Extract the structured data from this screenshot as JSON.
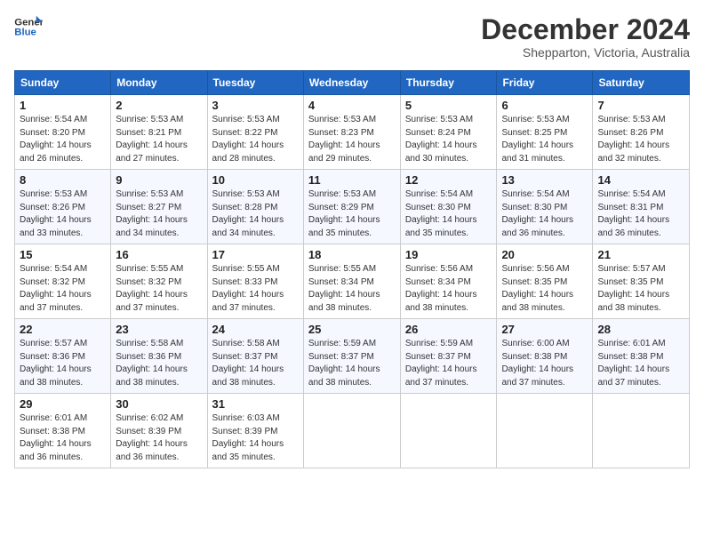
{
  "logo": {
    "line1": "General",
    "line2": "Blue"
  },
  "title": "December 2024",
  "subtitle": "Shepparton, Victoria, Australia",
  "days_header": [
    "Sunday",
    "Monday",
    "Tuesday",
    "Wednesday",
    "Thursday",
    "Friday",
    "Saturday"
  ],
  "weeks": [
    [
      {
        "day": "1",
        "sunrise": "5:54 AM",
        "sunset": "8:20 PM",
        "daylight": "14 hours and 26 minutes."
      },
      {
        "day": "2",
        "sunrise": "5:53 AM",
        "sunset": "8:21 PM",
        "daylight": "14 hours and 27 minutes."
      },
      {
        "day": "3",
        "sunrise": "5:53 AM",
        "sunset": "8:22 PM",
        "daylight": "14 hours and 28 minutes."
      },
      {
        "day": "4",
        "sunrise": "5:53 AM",
        "sunset": "8:23 PM",
        "daylight": "14 hours and 29 minutes."
      },
      {
        "day": "5",
        "sunrise": "5:53 AM",
        "sunset": "8:24 PM",
        "daylight": "14 hours and 30 minutes."
      },
      {
        "day": "6",
        "sunrise": "5:53 AM",
        "sunset": "8:25 PM",
        "daylight": "14 hours and 31 minutes."
      },
      {
        "day": "7",
        "sunrise": "5:53 AM",
        "sunset": "8:26 PM",
        "daylight": "14 hours and 32 minutes."
      }
    ],
    [
      {
        "day": "8",
        "sunrise": "5:53 AM",
        "sunset": "8:26 PM",
        "daylight": "14 hours and 33 minutes."
      },
      {
        "day": "9",
        "sunrise": "5:53 AM",
        "sunset": "8:27 PM",
        "daylight": "14 hours and 34 minutes."
      },
      {
        "day": "10",
        "sunrise": "5:53 AM",
        "sunset": "8:28 PM",
        "daylight": "14 hours and 34 minutes."
      },
      {
        "day": "11",
        "sunrise": "5:53 AM",
        "sunset": "8:29 PM",
        "daylight": "14 hours and 35 minutes."
      },
      {
        "day": "12",
        "sunrise": "5:54 AM",
        "sunset": "8:30 PM",
        "daylight": "14 hours and 35 minutes."
      },
      {
        "day": "13",
        "sunrise": "5:54 AM",
        "sunset": "8:30 PM",
        "daylight": "14 hours and 36 minutes."
      },
      {
        "day": "14",
        "sunrise": "5:54 AM",
        "sunset": "8:31 PM",
        "daylight": "14 hours and 36 minutes."
      }
    ],
    [
      {
        "day": "15",
        "sunrise": "5:54 AM",
        "sunset": "8:32 PM",
        "daylight": "14 hours and 37 minutes."
      },
      {
        "day": "16",
        "sunrise": "5:55 AM",
        "sunset": "8:32 PM",
        "daylight": "14 hours and 37 minutes."
      },
      {
        "day": "17",
        "sunrise": "5:55 AM",
        "sunset": "8:33 PM",
        "daylight": "14 hours and 37 minutes."
      },
      {
        "day": "18",
        "sunrise": "5:55 AM",
        "sunset": "8:34 PM",
        "daylight": "14 hours and 38 minutes."
      },
      {
        "day": "19",
        "sunrise": "5:56 AM",
        "sunset": "8:34 PM",
        "daylight": "14 hours and 38 minutes."
      },
      {
        "day": "20",
        "sunrise": "5:56 AM",
        "sunset": "8:35 PM",
        "daylight": "14 hours and 38 minutes."
      },
      {
        "day": "21",
        "sunrise": "5:57 AM",
        "sunset": "8:35 PM",
        "daylight": "14 hours and 38 minutes."
      }
    ],
    [
      {
        "day": "22",
        "sunrise": "5:57 AM",
        "sunset": "8:36 PM",
        "daylight": "14 hours and 38 minutes."
      },
      {
        "day": "23",
        "sunrise": "5:58 AM",
        "sunset": "8:36 PM",
        "daylight": "14 hours and 38 minutes."
      },
      {
        "day": "24",
        "sunrise": "5:58 AM",
        "sunset": "8:37 PM",
        "daylight": "14 hours and 38 minutes."
      },
      {
        "day": "25",
        "sunrise": "5:59 AM",
        "sunset": "8:37 PM",
        "daylight": "14 hours and 38 minutes."
      },
      {
        "day": "26",
        "sunrise": "5:59 AM",
        "sunset": "8:37 PM",
        "daylight": "14 hours and 37 minutes."
      },
      {
        "day": "27",
        "sunrise": "6:00 AM",
        "sunset": "8:38 PM",
        "daylight": "14 hours and 37 minutes."
      },
      {
        "day": "28",
        "sunrise": "6:01 AM",
        "sunset": "8:38 PM",
        "daylight": "14 hours and 37 minutes."
      }
    ],
    [
      {
        "day": "29",
        "sunrise": "6:01 AM",
        "sunset": "8:38 PM",
        "daylight": "14 hours and 36 minutes."
      },
      {
        "day": "30",
        "sunrise": "6:02 AM",
        "sunset": "8:39 PM",
        "daylight": "14 hours and 36 minutes."
      },
      {
        "day": "31",
        "sunrise": "6:03 AM",
        "sunset": "8:39 PM",
        "daylight": "14 hours and 35 minutes."
      },
      null,
      null,
      null,
      null
    ]
  ]
}
